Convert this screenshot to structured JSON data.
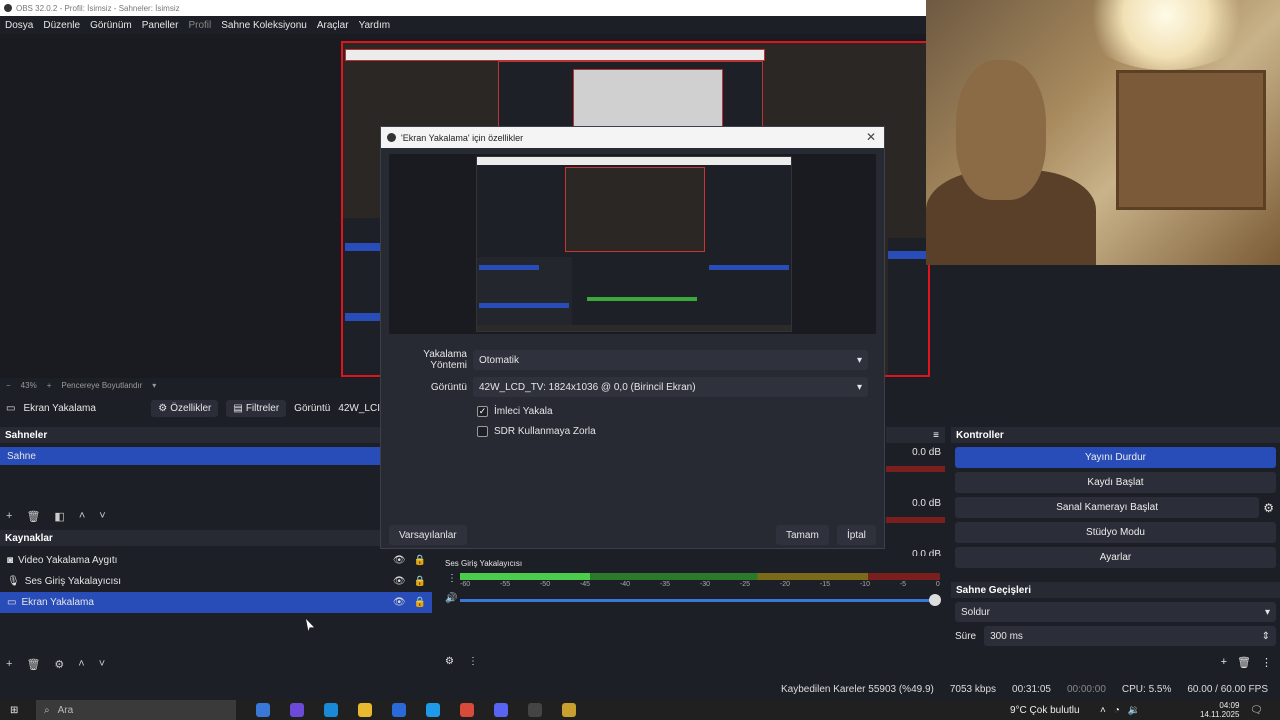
{
  "window": {
    "title": "OBS 32.0.2 - Profil: İsimsiz - Sahneler: İsimsiz"
  },
  "menu": [
    "Dosya",
    "Düzenle",
    "Görünüm",
    "Paneller",
    "Profil",
    "Sahne Koleksiyonu",
    "Araçlar",
    "Yardım"
  ],
  "zoom": {
    "minus": "−",
    "value": "43%",
    "plus": "+",
    "label": "Pencereye Boyutlandır"
  },
  "source_toolbar": {
    "source": "Ekran Yakalama",
    "properties": "Özellikler",
    "filters": "Filtreler",
    "display_label": "Görüntü",
    "display_value": "42W_LCI"
  },
  "scenes": {
    "title": "Sahneler",
    "items": [
      "Sahne"
    ]
  },
  "sources": {
    "title": "Kaynaklar",
    "items": [
      "Video Yakalama Aygıtı",
      "Ses Giriş Yakalayıcısı",
      "Ekran Yakalama"
    ]
  },
  "mixer": {
    "channels": [
      {
        "name": "Ses Giriş Yakalayıcısı",
        "db": "0.0 dB",
        "level": 0.27
      },
      {
        "name": "",
        "db": "0.0 dB"
      },
      {
        "name": "",
        "db": "0.0 dB"
      }
    ],
    "ticks": [
      "-60",
      "-55",
      "-50",
      "-45",
      "-40",
      "-35",
      "-30",
      "-25",
      "-20",
      "-15",
      "-10",
      "-5",
      "0"
    ]
  },
  "controls": {
    "title": "Kontroller",
    "stop_stream": "Yayını Durdur",
    "start_record": "Kaydı Başlat",
    "virtual_cam": "Sanal Kamerayı Başlat",
    "studio_mode": "Stüdyo Modu",
    "settings": "Ayarlar"
  },
  "transitions": {
    "title": "Sahne Geçişleri",
    "selected": "Soldur",
    "duration_label": "Süre",
    "duration": "300 ms"
  },
  "status": {
    "dropped": "Kaybedilen Kareler 55903 (%49.9)",
    "bitrate": "7053 kbps",
    "stream_time": "00:31:05",
    "record_time": "00:00:00",
    "cpu": "CPU: 5.5%",
    "fps": "60.00 / 60.00 FPS"
  },
  "dialog": {
    "title": "'Ekran Yakalama' için özellikler",
    "capture_method_label": "Yakalama Yöntemi",
    "capture_method": "Otomatik",
    "display_label": "Görüntü",
    "display": "42W_LCD_TV: 1824x1036 @ 0,0 (Birincil Ekran)",
    "capture_cursor": "İmleci Yakala",
    "force_sdr": "SDR Kullanmaya Zorla",
    "defaults": "Varsayılanlar",
    "ok": "Tamam",
    "cancel": "İptal"
  },
  "taskbar": {
    "search": "Ara",
    "weather": "9°C  Çok bulutlu",
    "time": "04:09",
    "date": "14.11.2025"
  }
}
